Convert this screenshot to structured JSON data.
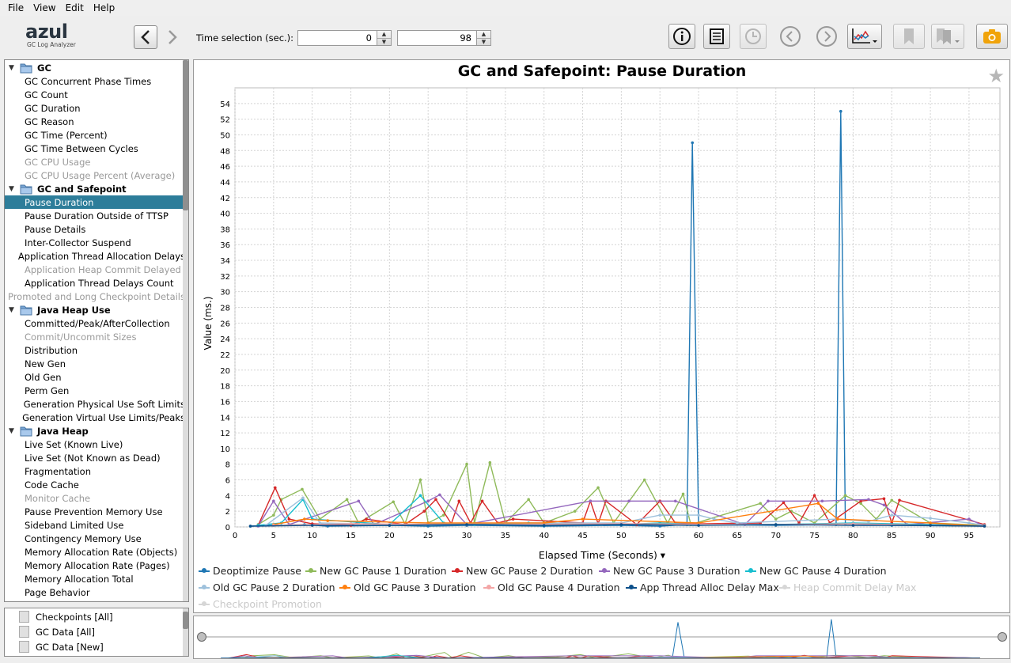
{
  "menu": [
    "File",
    "View",
    "Edit",
    "Help"
  ],
  "logo": {
    "brand": "azul",
    "subtitle": "GC Log Analyzer"
  },
  "time_selection": {
    "label": "Time selection (sec.):",
    "start": "0",
    "end": "98"
  },
  "toolbar_icons": [
    "info-icon",
    "report-icon",
    "clock-icon",
    "prev-icon",
    "next-icon",
    "chart-type-icon",
    "bookmark-icon",
    "bookmarks-icon",
    "camera-icon"
  ],
  "tree": [
    {
      "label": "GC",
      "group": true
    },
    {
      "label": "GC Concurrent Phase Times"
    },
    {
      "label": "GC Count"
    },
    {
      "label": "GC Duration"
    },
    {
      "label": "GC Reason"
    },
    {
      "label": "GC Time (Percent)"
    },
    {
      "label": "GC Time Between Cycles"
    },
    {
      "label": "GC CPU Usage",
      "disabled": true
    },
    {
      "label": "GC CPU Usage Percent (Average)",
      "disabled": true
    },
    {
      "label": "GC and Safepoint",
      "group": true
    },
    {
      "label": "Pause Duration",
      "selected": true
    },
    {
      "label": "Pause Duration Outside of TTSP"
    },
    {
      "label": "Pause Details"
    },
    {
      "label": "Inter-Collector Suspend"
    },
    {
      "label": "Application Thread Allocation Delays"
    },
    {
      "label": "Application Heap Commit Delayed",
      "disabled": true
    },
    {
      "label": "Application Thread Delays Count"
    },
    {
      "label": "Promoted and Long Checkpoint Details",
      "disabled": true
    },
    {
      "label": "Java Heap Use",
      "group": true
    },
    {
      "label": "Committed/Peak/AfterCollection"
    },
    {
      "label": "Commit/Uncommit Sizes",
      "disabled": true
    },
    {
      "label": "Distribution"
    },
    {
      "label": "New Gen"
    },
    {
      "label": "Old Gen"
    },
    {
      "label": "Perm Gen"
    },
    {
      "label": "Generation Physical Use Soft Limits"
    },
    {
      "label": "Generation Virtual Use Limits/Peaks"
    },
    {
      "label": "Java Heap",
      "group": true
    },
    {
      "label": "Live Set (Known Live)"
    },
    {
      "label": "Live Set (Not Known as Dead)"
    },
    {
      "label": "Fragmentation"
    },
    {
      "label": "Code Cache"
    },
    {
      "label": "Monitor Cache",
      "disabled": true
    },
    {
      "label": "Pause Prevention Memory Use"
    },
    {
      "label": "Sideband Limited Use"
    },
    {
      "label": "Contingency Memory Use"
    },
    {
      "label": "Memory Allocation Rate (Objects)"
    },
    {
      "label": "Memory Allocation Rate (Pages)"
    },
    {
      "label": "Memory Allocation Total"
    },
    {
      "label": "Page Behavior"
    }
  ],
  "files": [
    "Checkpoints [All]",
    "GC Data [All]",
    "GC Data [New]"
  ],
  "chart_data": {
    "type": "line",
    "title": "GC and Safepoint: Pause Duration",
    "xlabel": "Elapsed Time (Seconds) ▾",
    "ylabel": "Value (ms.)",
    "xlim": [
      0,
      99
    ],
    "ylim": [
      0,
      56
    ],
    "xticks": [
      0,
      5,
      10,
      15,
      20,
      25,
      30,
      35,
      40,
      45,
      50,
      55,
      60,
      65,
      70,
      75,
      80,
      85,
      90,
      95
    ],
    "yticks": [
      0,
      2,
      4,
      6,
      8,
      10,
      12,
      14,
      16,
      18,
      20,
      22,
      24,
      26,
      28,
      30,
      32,
      34,
      36,
      38,
      40,
      42,
      44,
      46,
      48,
      50,
      52,
      54
    ],
    "grid": true,
    "legend_position": "bottom",
    "series": [
      {
        "name": "Deoptimize Pause",
        "color": "#1f77b4",
        "x": [
          2,
          5,
          9,
          12,
          20,
          25,
          30,
          40,
          50,
          55,
          58.5,
          59.2,
          60,
          70,
          77.8,
          78.4,
          79,
          85,
          97
        ],
        "y": [
          0.1,
          0.2,
          0.3,
          0.1,
          0.2,
          0.1,
          0.2,
          0.1,
          0.2,
          0.1,
          0.3,
          49,
          0.3,
          0.2,
          0.3,
          53,
          0.4,
          0.2,
          0.1
        ]
      },
      {
        "name": "New GC Pause 1 Duration",
        "color": "#8fba5a",
        "x": [
          3,
          5,
          6,
          8.7,
          11,
          14.5,
          16,
          20.5,
          22,
          24,
          25,
          27,
          30,
          31,
          33,
          35,
          38,
          40,
          44,
          47,
          49,
          53,
          56,
          58,
          59,
          68,
          70,
          72,
          75,
          79,
          81,
          83,
          85,
          90,
          97
        ],
        "y": [
          0.3,
          1.5,
          3.5,
          4.8,
          1,
          3.5,
          0.5,
          3.2,
          0.4,
          6,
          0.5,
          1.5,
          8,
          0.5,
          8.2,
          0.5,
          3.5,
          0.5,
          2,
          5,
          0.5,
          6,
          0.5,
          4.2,
          0.3,
          3,
          1,
          2,
          0.5,
          4,
          3,
          1,
          3.4,
          0.5,
          0.2
        ]
      },
      {
        "name": "New GC Pause 2 Duration",
        "color": "#d62728",
        "x": [
          3,
          5.2,
          7,
          10,
          15,
          17,
          22,
          24.5,
          26,
          28,
          29,
          30.5,
          32,
          34,
          36,
          45,
          46,
          47,
          48,
          52,
          55,
          57,
          60,
          68,
          71,
          73,
          75,
          77,
          81,
          84,
          85,
          86,
          97
        ],
        "y": [
          0.2,
          5,
          1,
          0.4,
          0.2,
          1,
          0.3,
          2,
          3.5,
          0.4,
          3.3,
          0.5,
          3.3,
          0.5,
          1,
          0.5,
          3.3,
          0.4,
          3.3,
          0.3,
          3.3,
          0.5,
          0.4,
          0.5,
          3.1,
          0.5,
          4,
          0.5,
          3.3,
          3.6,
          0.5,
          3.4,
          0.3
        ]
      },
      {
        "name": "New GC Pause 3 Duration",
        "color": "#9467bd",
        "x": [
          3,
          5,
          7,
          16,
          18,
          25,
          26.5,
          30,
          46,
          51,
          57,
          66,
          69,
          76,
          82,
          84,
          87,
          95,
          97
        ],
        "y": [
          0.1,
          3.3,
          0.3,
          3.3,
          0.3,
          3.3,
          4.1,
          0.3,
          3.3,
          3.3,
          3.3,
          0.3,
          3.3,
          3.3,
          3.5,
          2.8,
          0.3,
          1,
          0.1
        ]
      },
      {
        "name": "New GC Pause 4 Duration",
        "color": "#17becf",
        "x": [
          3,
          6,
          8.8,
          10,
          20,
          24,
          27,
          31,
          38,
          50,
          55,
          60,
          70,
          80,
          90,
          97
        ],
        "y": [
          0.2,
          0.5,
          3.5,
          1,
          0.3,
          4,
          0.5,
          0.3,
          0.5,
          0.3,
          0.5,
          0.3,
          0.3,
          0.5,
          0.3,
          0.1
        ]
      },
      {
        "name": "Old GC Pause 2 Duration",
        "color": "#9ec1dc",
        "x": [
          4,
          8.8,
          11,
          20,
          35,
          50,
          55,
          60,
          62,
          65,
          78,
          82,
          85,
          90,
          95,
          97
        ],
        "y": [
          0.2,
          3.7,
          0.5,
          0.3,
          0.5,
          0.5,
          1.5,
          1.5,
          1,
          0.5,
          1,
          0.7,
          1.5,
          1.1,
          0.5,
          0.2
        ]
      },
      {
        "name": "Old GC Pause 3 Duration",
        "color": "#ff7f0e",
        "x": [
          5,
          9,
          12,
          25,
          40,
          45,
          60,
          75.5,
          78,
          90,
          97
        ],
        "y": [
          0.3,
          1,
          0.8,
          0.5,
          0.5,
          1,
          0.5,
          3,
          1,
          0.5,
          0.1
        ]
      },
      {
        "name": "Old GC Pause 4 Duration",
        "color": "#f3a6a6",
        "x": [
          5,
          15,
          30,
          50,
          70,
          80,
          97
        ],
        "y": [
          0.2,
          0.4,
          0.3,
          0.4,
          0.3,
          0.4,
          0.1
        ]
      },
      {
        "name": "App Thread Alloc Delay Max",
        "color": "#0b4f8a",
        "x": [
          2,
          10,
          20,
          30,
          40,
          50,
          60,
          70,
          80,
          90,
          97
        ],
        "y": [
          0.1,
          0.2,
          0.2,
          0.3,
          0.2,
          0.3,
          0.2,
          0.3,
          0.2,
          0.2,
          0.1
        ]
      },
      {
        "name": "Heap Commit Delay Max",
        "color": "#d6d6d6",
        "dim": true,
        "x": [],
        "y": []
      },
      {
        "name": "Checkpoint Promotion",
        "color": "#d6d6d6",
        "dim": true,
        "x": [],
        "y": []
      }
    ]
  }
}
